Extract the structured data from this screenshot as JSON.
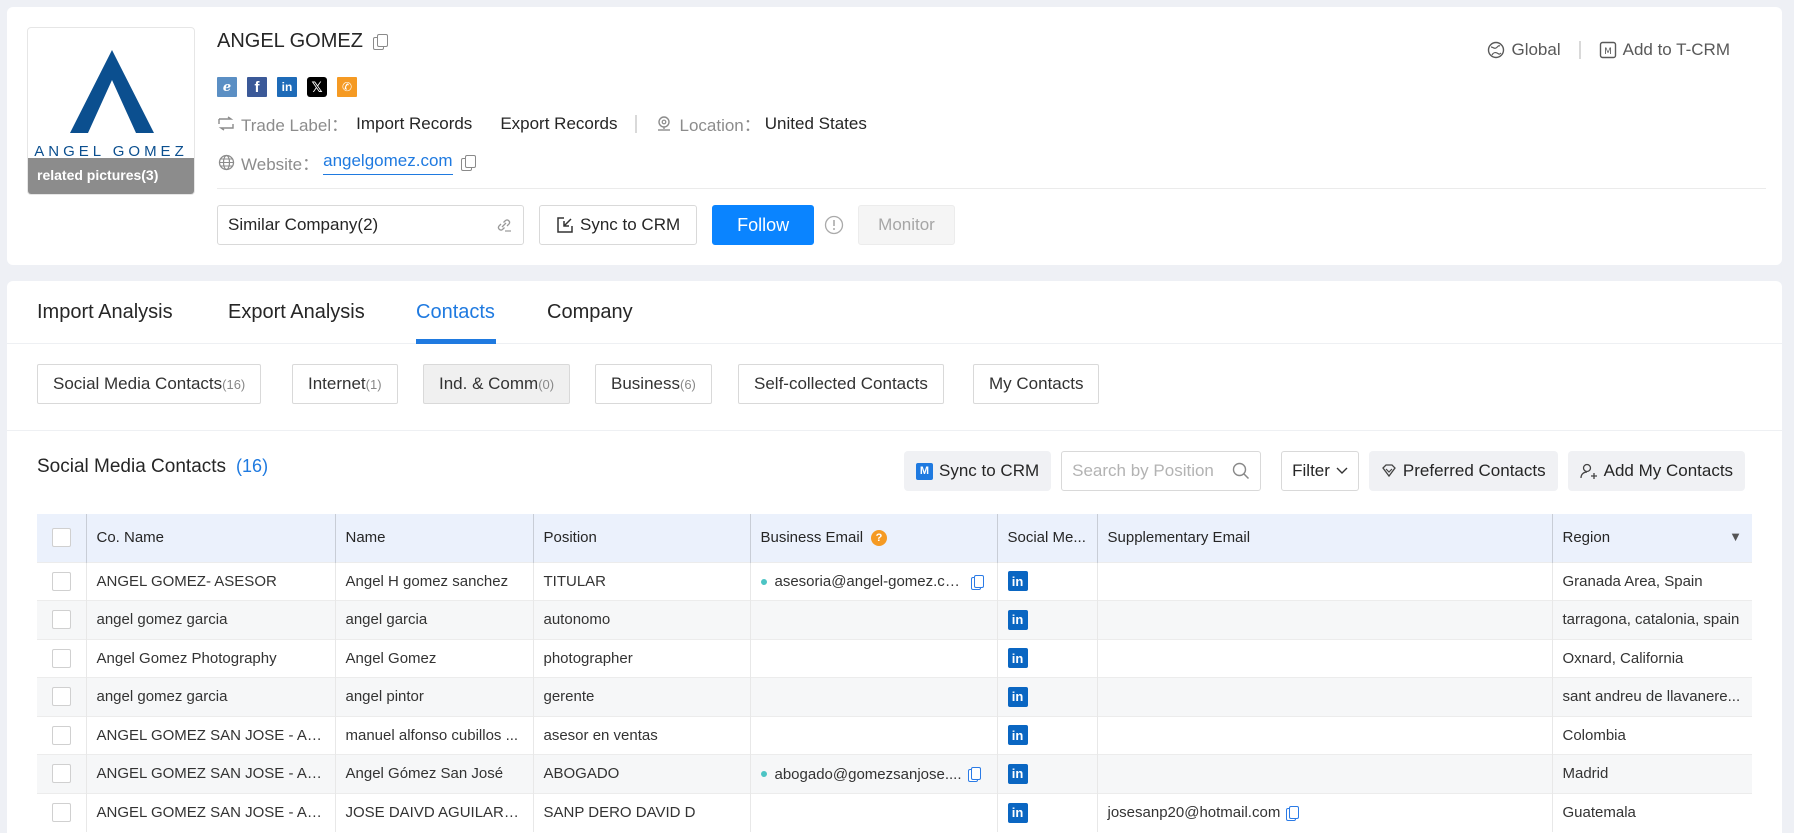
{
  "company": {
    "name": "ANGEL GOMEZ",
    "logo_text": "ANGEL GOMEZ",
    "related_pictures": "related pictures(3)",
    "social_icons": [
      "ie-icon",
      "facebook-icon",
      "linkedin-icon",
      "x-icon",
      "phone-icon"
    ],
    "trade_label": "Trade Label：",
    "trade_values": [
      "Import Records",
      "Export Records"
    ],
    "location_label": "Location：",
    "location_value": "United States",
    "website_label": "Website：",
    "website_value": "angelgomez.com"
  },
  "top_right": {
    "global": "Global",
    "add_tcrm": "Add to T-CRM"
  },
  "actions": {
    "similar_company": "Similar Company(2)",
    "sync_crm": "Sync to CRM",
    "follow": "Follow",
    "monitor": "Monitor"
  },
  "tabs": [
    {
      "label": "Import Analysis",
      "active": false
    },
    {
      "label": "Export Analysis",
      "active": false
    },
    {
      "label": "Contacts",
      "active": true
    },
    {
      "label": "Company",
      "active": false
    }
  ],
  "subtabs": [
    {
      "label": "Social Media Contacts",
      "count": "(16)"
    },
    {
      "label": "Internet",
      "count": "(1)"
    },
    {
      "label": "Ind. & Comm",
      "count": "(0)"
    },
    {
      "label": "Business",
      "count": "(6)"
    },
    {
      "label": "Self-collected Contacts",
      "count": ""
    },
    {
      "label": "My Contacts",
      "count": ""
    }
  ],
  "section": {
    "title": "Social Media Contacts",
    "count": "(16)"
  },
  "toolbar": {
    "sync_crm": "Sync to CRM",
    "search_placeholder": "Search by Position",
    "filter": "Filter",
    "preferred": "Preferred Contacts",
    "add_contacts": "Add My Contacts"
  },
  "table": {
    "columns": [
      "Co. Name",
      "Name",
      "Position",
      "Business Email",
      "Social Me...",
      "Supplementary Email",
      "Region"
    ],
    "rows": [
      {
        "co": "ANGEL GOMEZ- ASESOR",
        "name": "Angel H gomez sanchez",
        "position": "TITULAR",
        "email": "asesoria@angel-gomez.co...",
        "social": "linkedin",
        "supp": "",
        "region": "Granada Area, Spain"
      },
      {
        "co": "angel gomez garcia",
        "name": "angel garcia",
        "position": "autonomo",
        "email": "",
        "social": "linkedin",
        "supp": "",
        "region": "tarragona, catalonia, spain"
      },
      {
        "co": "Angel Gomez Photography",
        "name": "Angel Gomez",
        "position": "photographer",
        "email": "",
        "social": "linkedin",
        "supp": "",
        "region": "Oxnard, California"
      },
      {
        "co": "angel gomez garcia",
        "name": "angel pintor",
        "position": "gerente",
        "email": "",
        "social": "linkedin",
        "supp": "",
        "region": "sant andreu de llavanere..."
      },
      {
        "co": "ANGEL GOMEZ SAN JOSE - ABO...",
        "name": "manuel alfonso cubillos ...",
        "position": "asesor en ventas",
        "email": "",
        "social": "linkedin",
        "supp": "",
        "region": "Colombia"
      },
      {
        "co": "ANGEL GOMEZ SAN JOSE - ABO...",
        "name": "Angel Gómez San José",
        "position": "ABOGADO",
        "email": "abogado@gomezsanjose....",
        "social": "linkedin",
        "supp": "",
        "region": "Madrid"
      },
      {
        "co": "ANGEL GOMEZ SAN JOSE - ABO...",
        "name": "JOSE DAIVD AGUILAR J...",
        "position": "SANP DERO DAVID D",
        "email": "",
        "social": "linkedin",
        "supp": "josesanp20@hotmail.com",
        "region": "Guatemala"
      }
    ]
  },
  "colors": {
    "accent": "#1f7ae0",
    "primary_button": "#0a84ff",
    "header_bg": "#ebf1fc",
    "logo_blue": "#0b4f8f",
    "linkedin": "#0a66c2",
    "help_orange": "#f59a23"
  }
}
